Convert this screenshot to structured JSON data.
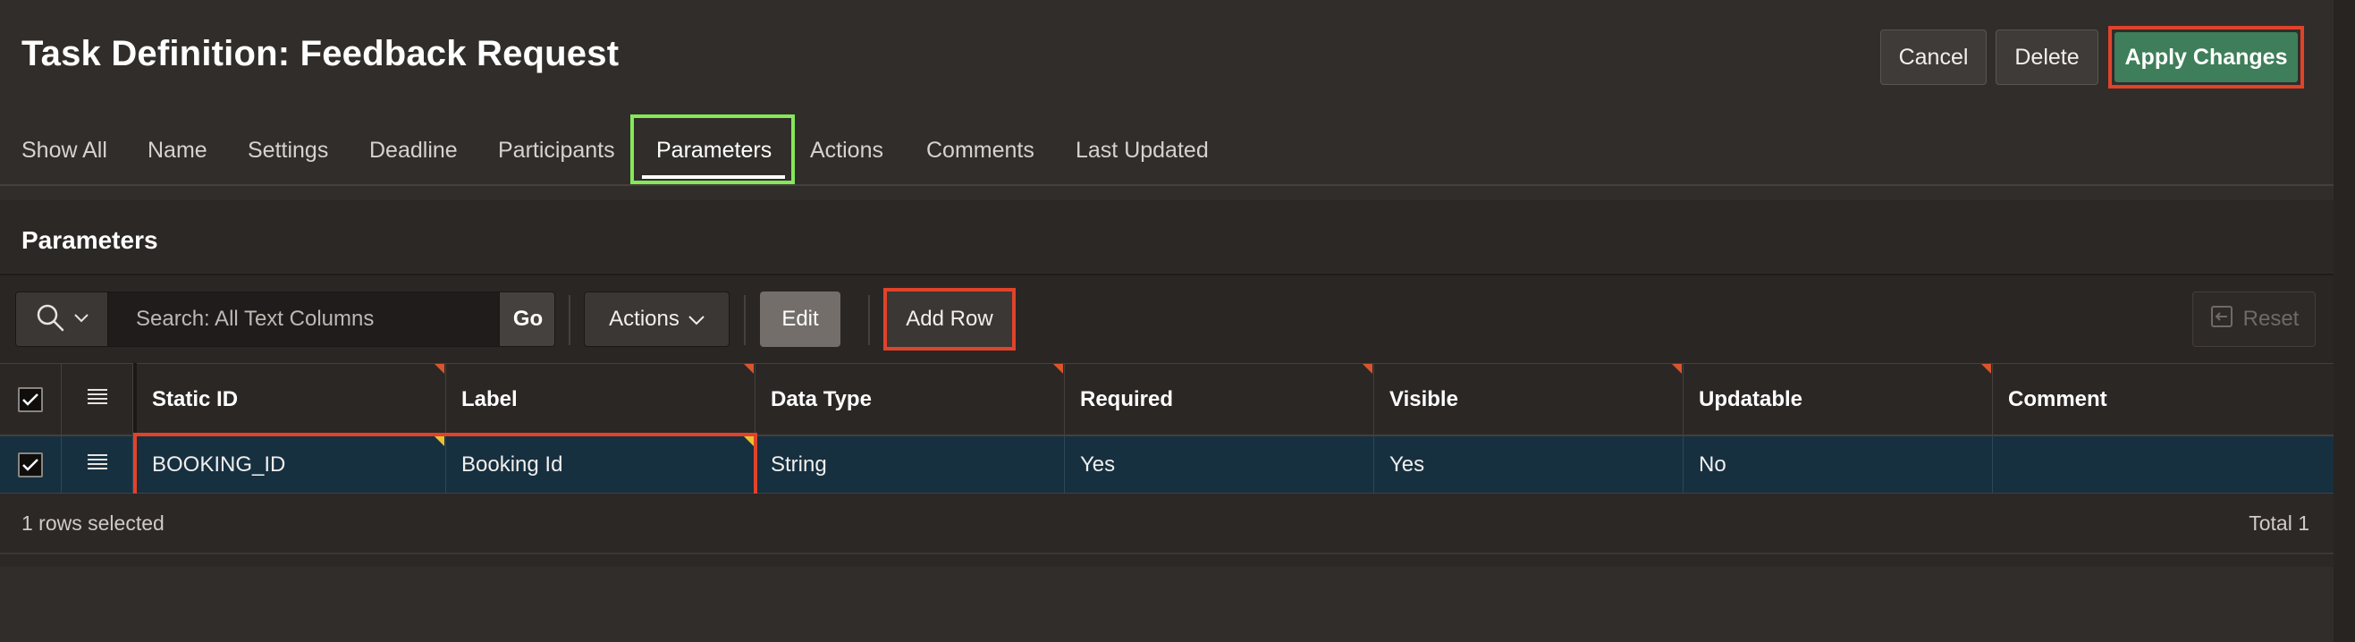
{
  "header": {
    "title": "Task Definition: Feedback Request",
    "cancel_label": "Cancel",
    "delete_label": "Delete",
    "apply_label": "Apply Changes"
  },
  "tabs": [
    {
      "label": "Show All"
    },
    {
      "label": "Name"
    },
    {
      "label": "Settings"
    },
    {
      "label": "Deadline"
    },
    {
      "label": "Participants"
    },
    {
      "label": "Parameters",
      "active": true
    },
    {
      "label": "Actions"
    },
    {
      "label": "Comments"
    },
    {
      "label": "Last Updated"
    }
  ],
  "region": {
    "title": "Parameters"
  },
  "toolbar": {
    "search_placeholder": "Search: All Text Columns",
    "go_label": "Go",
    "actions_label": "Actions",
    "edit_label": "Edit",
    "add_row_label": "Add Row",
    "reset_label": "Reset"
  },
  "grid": {
    "columns": [
      "Static ID",
      "Label",
      "Data Type",
      "Required",
      "Visible",
      "Updatable",
      "Comment"
    ],
    "rows": [
      {
        "selected": true,
        "cells": [
          "BOOKING_ID",
          "Booking Id",
          "String",
          "Yes",
          "Yes",
          "No",
          ""
        ]
      }
    ],
    "footer_selected": "1 rows selected",
    "footer_total": "Total 1"
  },
  "colors": {
    "background": "#312d2a",
    "apply_button": "#3e7e5a",
    "highlight_red": "#e0432a",
    "highlight_green": "#85e859",
    "selected_row": "#163040",
    "edit_button": "#736e69"
  }
}
